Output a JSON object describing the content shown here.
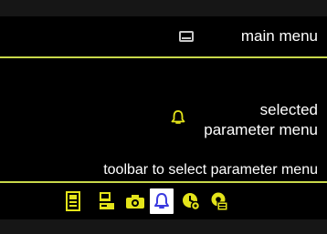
{
  "header": {
    "main_menu_label": "main menu",
    "main_menu_icon": "menu-screen-icon"
  },
  "content": {
    "selected_label_line1": "selected",
    "selected_label_line2": "parameter menu",
    "selected_icon": "bell-icon"
  },
  "toolbar": {
    "label": "toolbar to select parameter menu",
    "items": [
      {
        "name": "device-params-icon",
        "selected": false
      },
      {
        "name": "monitor-params-icon",
        "selected": false
      },
      {
        "name": "camera-icon",
        "selected": false
      },
      {
        "name": "alarm-bell-icon",
        "selected": true
      },
      {
        "name": "clock-gear-icon",
        "selected": false
      },
      {
        "name": "display-gear-icon",
        "selected": false
      }
    ]
  },
  "colors": {
    "accent": "#c8d84a",
    "icon_yellow": "#e4e41a",
    "selected_bg": "#ffffff",
    "selected_icon": "#3a3adf",
    "text": "#ffffff",
    "background": "#000000"
  }
}
